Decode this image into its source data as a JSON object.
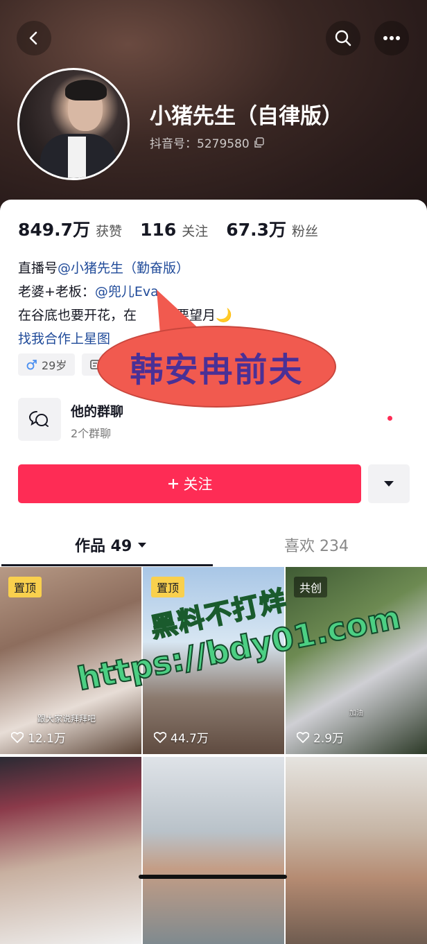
{
  "profile": {
    "name": "小猪先生（自律版）",
    "douyin_id": "抖音号：5279580"
  },
  "stats": [
    {
      "num": "849.7万",
      "label": "获赞"
    },
    {
      "num": "116",
      "label": "关注"
    },
    {
      "num": "67.3万",
      "label": "粉丝"
    }
  ],
  "bio": {
    "line1_prefix": "直播号",
    "line1_link": "@小猪先生（勤奋版）",
    "line2_prefix": "老婆+老板：",
    "line2_link": "@兜儿Eva",
    "line3": "在谷底也要开花，在　　也要望月🌙",
    "line4_link": "找我合作上星图"
  },
  "tags": {
    "gender_age": "29岁"
  },
  "overlay_bubble": "韩安冉前夫",
  "group_chat": {
    "title": "他的群聊",
    "subtitle": "2个群聊"
  },
  "actions": {
    "follow": "关注"
  },
  "tabs": {
    "works": "作品 49",
    "likes": "喜欢 234"
  },
  "watermark": {
    "line1": "黑料不打烊",
    "line2": "https://bdy01.com"
  },
  "videos": [
    {
      "badge": "置顶",
      "likes": "12.1万",
      "caption": "跟大家说拜拜吧"
    },
    {
      "badge": "置顶",
      "likes": "44.7万"
    },
    {
      "badge": "共创",
      "likes": "2.9万",
      "caption": "加油"
    },
    {
      "badge": "",
      "likes": ""
    },
    {
      "badge": "",
      "likes": ""
    },
    {
      "badge": "",
      "likes": ""
    }
  ],
  "colors": {
    "accent": "#fe2c55",
    "link": "#1f4a99"
  }
}
